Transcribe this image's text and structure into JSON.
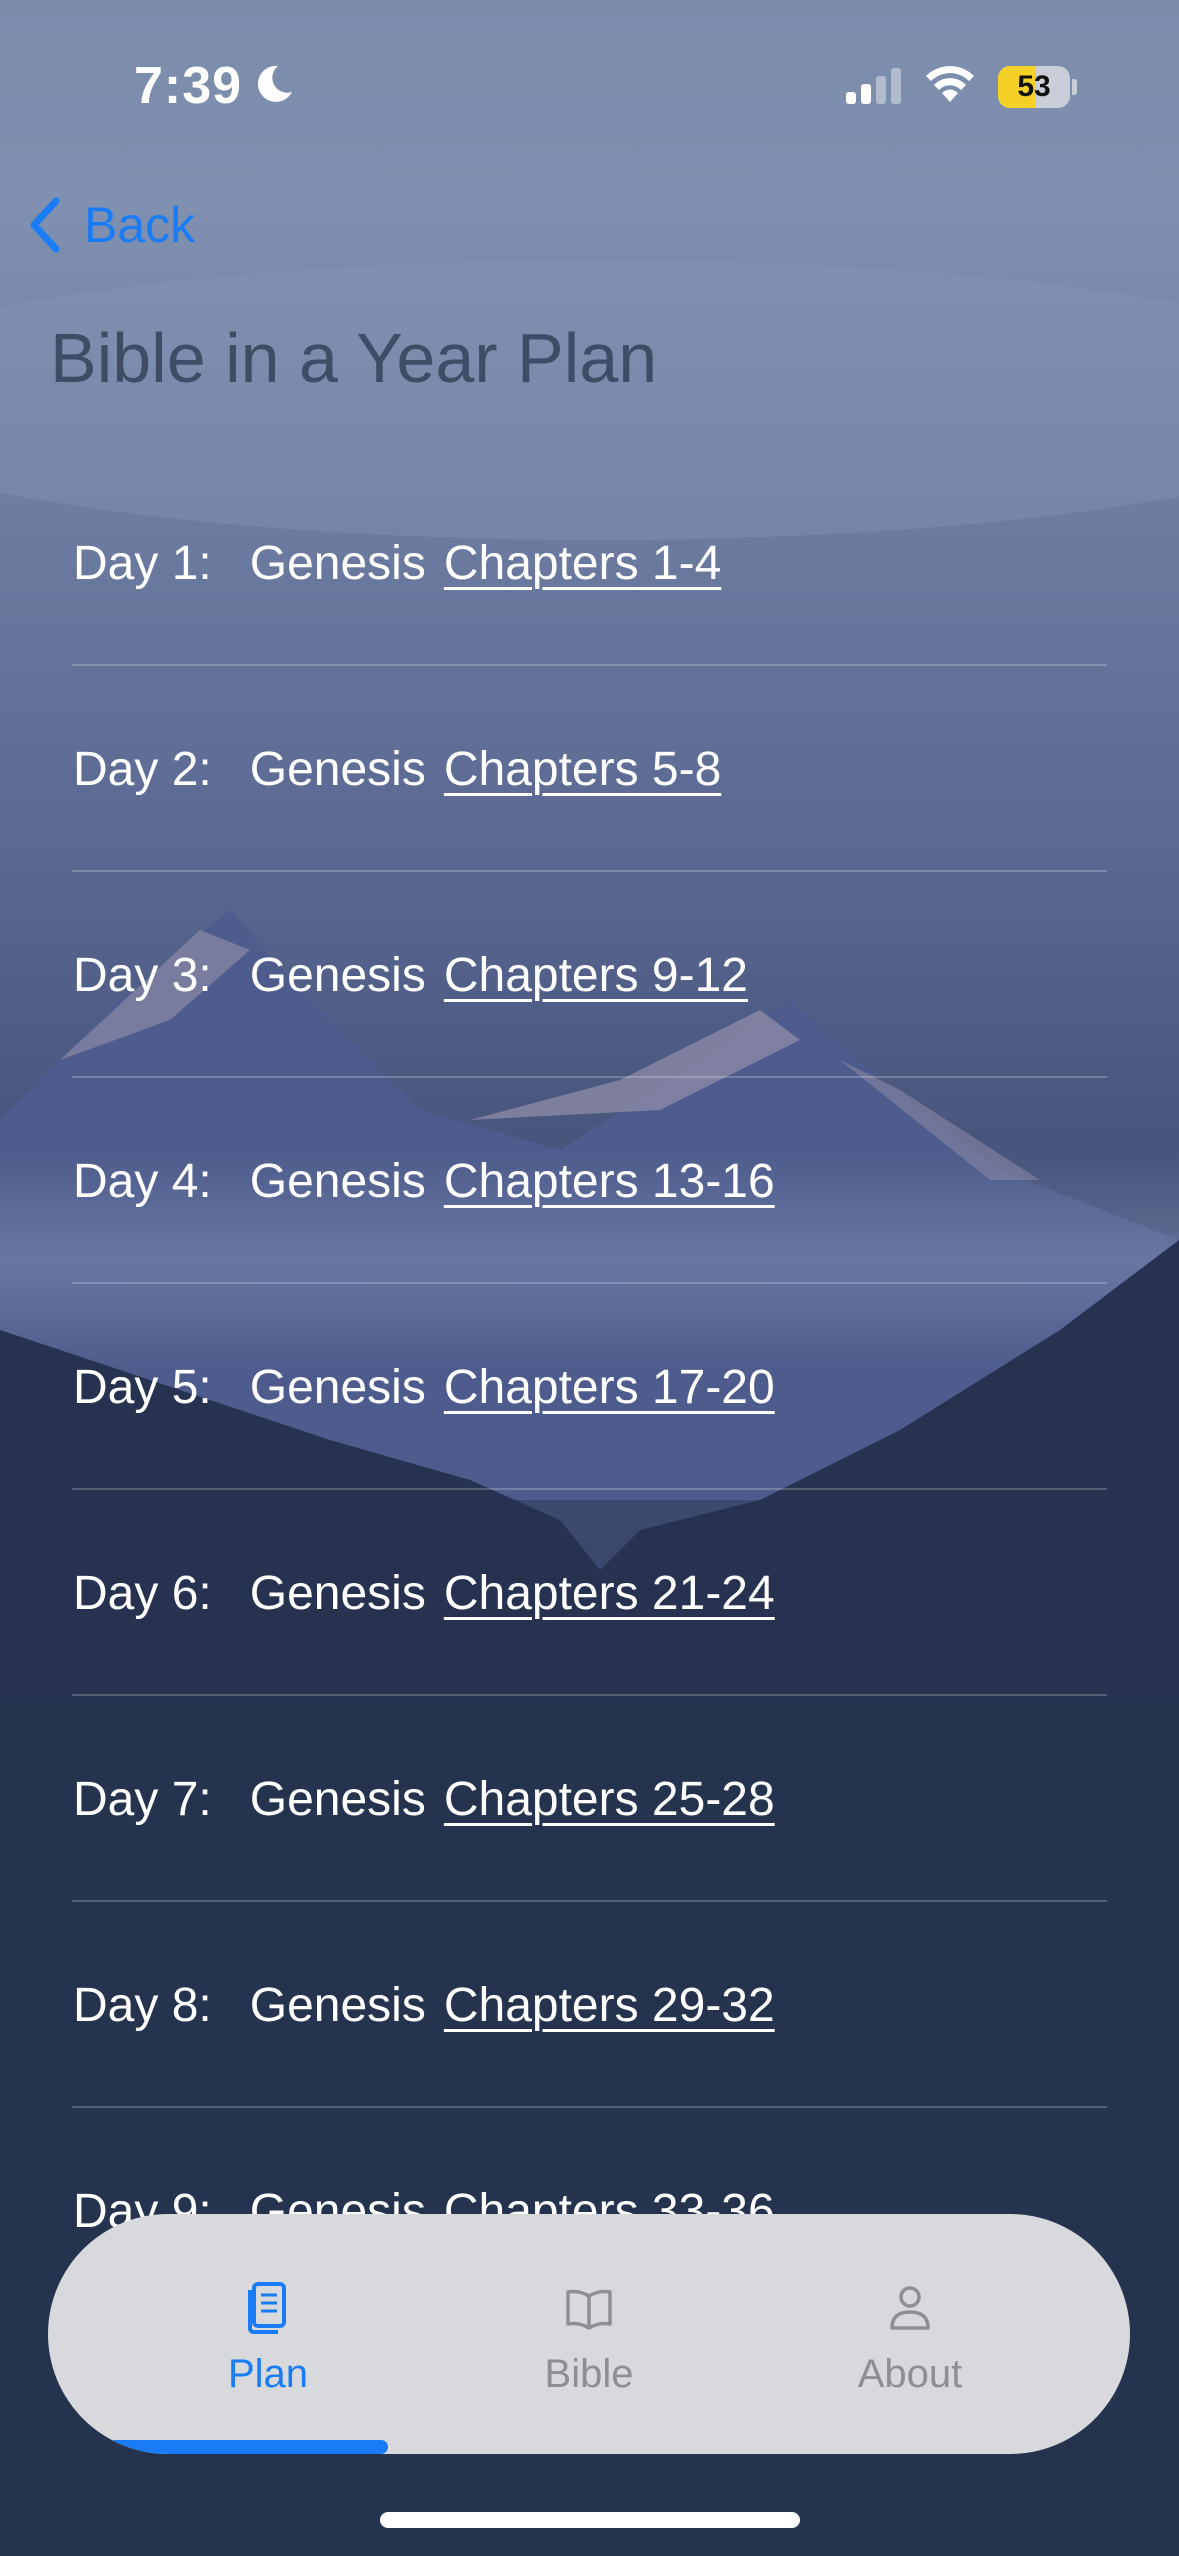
{
  "status_bar": {
    "time": "7:39",
    "battery_percent": "53",
    "battery_level": 0.53,
    "icons": [
      "moon-icon",
      "signal-icon",
      "wifi-icon",
      "battery-icon"
    ]
  },
  "nav": {
    "back_label": "Back"
  },
  "page": {
    "title": "Bible in a Year Plan"
  },
  "readings": [
    {
      "day": "Day 1:",
      "book": "Genesis",
      "chapters": "Chapters 1-4"
    },
    {
      "day": "Day 2:",
      "book": "Genesis",
      "chapters": "Chapters 5-8"
    },
    {
      "day": "Day 3:",
      "book": "Genesis",
      "chapters": "Chapters 9-12"
    },
    {
      "day": "Day 4:",
      "book": "Genesis",
      "chapters": "Chapters 13-16"
    },
    {
      "day": "Day 5:",
      "book": "Genesis",
      "chapters": "Chapters 17-20"
    },
    {
      "day": "Day 6:",
      "book": "Genesis",
      "chapters": "Chapters 21-24"
    },
    {
      "day": "Day 7:",
      "book": "Genesis",
      "chapters": "Chapters 25-28"
    },
    {
      "day": "Day 8:",
      "book": "Genesis",
      "chapters": "Chapters 29-32"
    },
    {
      "day": "Day 9:",
      "book": "Genesis",
      "chapters": "Chapters 33-36"
    }
  ],
  "tab_bar": {
    "tabs": [
      {
        "label": "Plan",
        "icon": "plan-icon",
        "active": true
      },
      {
        "label": "Bible",
        "icon": "book-icon",
        "active": false
      },
      {
        "label": "About",
        "icon": "person-icon",
        "active": false
      }
    ]
  },
  "colors": {
    "accent": "#1a7cf4",
    "title": "#3e4c66",
    "tab_bar_bg": "#d8d9dd",
    "battery_fill": "#f5d127",
    "row_text": "#ffffff"
  }
}
